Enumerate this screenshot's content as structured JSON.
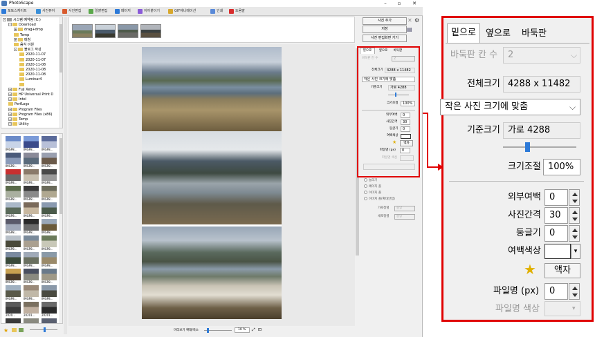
{
  "app": {
    "title": "PhotoScape",
    "tabs": [
      "포토스케이프",
      "사진뷰어",
      "사진편집",
      "일괄편집",
      "페이지",
      "이어붙이기",
      "GIF애니메이션",
      "인쇄",
      "도움말"
    ]
  },
  "tree": {
    "items": [
      {
        "label": "시스템 예약됨 (C:)",
        "indent": 0,
        "sign": "-"
      },
      {
        "label": "Download",
        "indent": 1,
        "sign": "-"
      },
      {
        "label": "drag+drop",
        "indent": 2,
        "sign": "+"
      },
      {
        "label": "Temp",
        "indent": 2,
        "sign": ""
      },
      {
        "label": "매칭",
        "indent": 2,
        "sign": "+"
      },
      {
        "label": "음식 이원",
        "indent": 2,
        "sign": ""
      },
      {
        "label": "블로그 작성",
        "indent": 2,
        "sign": "-"
      },
      {
        "label": "2020-11-07",
        "indent": 3,
        "sign": ""
      },
      {
        "label": "2020-11-07",
        "indent": 3,
        "sign": ""
      },
      {
        "label": "2020-11-08",
        "indent": 3,
        "sign": ""
      },
      {
        "label": "2020-11-08",
        "indent": 3,
        "sign": ""
      },
      {
        "label": "2020-11-08",
        "indent": 3,
        "sign": ""
      },
      {
        "label": "Luminar4",
        "indent": 3,
        "sign": ""
      },
      {
        "label": "",
        "indent": 3,
        "sign": ""
      },
      {
        "label": "Fuji Xerox",
        "indent": 1,
        "sign": "+"
      },
      {
        "label": "HP Universal Print D",
        "indent": 1,
        "sign": "+"
      },
      {
        "label": "Intel",
        "indent": 1,
        "sign": "+"
      },
      {
        "label": "PerfLogs",
        "indent": 1,
        "sign": ""
      },
      {
        "label": "Program Files",
        "indent": 1,
        "sign": "+"
      },
      {
        "label": "Program Files (x86)",
        "indent": 1,
        "sign": "+"
      },
      {
        "label": "Temp",
        "indent": 1,
        "sign": "+"
      },
      {
        "label": "Utility",
        "indent": 1,
        "sign": "+"
      }
    ]
  },
  "thumbnails": {
    "labels": [
      "IMGP8...",
      "IMGP8...",
      "IMGP8...",
      "IMGP8...",
      "IMGP8...",
      "IMGP8...",
      "IMGP8...",
      "IMGP8...",
      "IMGP8...",
      "IMGP8...",
      "IMGP8...",
      "IMGP8...",
      "IMGP8...",
      "IMGP8...",
      "IMGP8...",
      "IMGP8...",
      "IMGP8...",
      "IMGP8...",
      "IMGP8...",
      "IMGP8...",
      "IMGP8...",
      "IMGP8...",
      "IMGP8...",
      "IMGP8...",
      "IMGP8...",
      "IMGP8...",
      "IMGP8...",
      "IMGP8...",
      "IMGP8...",
      "IMGP8...",
      "2020...",
      "20201...",
      "20201...",
      "20201...",
      "20201...",
      "20201..."
    ]
  },
  "zoom_bar": {
    "label": "미리보기 확대/축소",
    "value": "10 %"
  },
  "right_panel": {
    "add_photo": "사진 추가",
    "save": "저장",
    "edit_photo": "사진 편집화면 가기"
  },
  "settings": {
    "tabs": [
      "밑으로",
      "옆으로",
      "바둑판"
    ],
    "grid_cols_label": "바둑판 칸 수",
    "grid_cols_value": "2",
    "total_size_label": "전체크기",
    "total_size_value": "4288 x 11482",
    "fit_option": "작은 사진 크기에 맞춤",
    "base_size_label": "기준크기",
    "base_size_value": "가로 4288",
    "scale_label": "크기조절",
    "scale_value": "100%",
    "outer_margin_label": "외부여백",
    "outer_margin_value": "0",
    "spacing_label": "사진간격",
    "spacing_value": "30",
    "rounding_label": "둥글기",
    "rounding_value": "0",
    "margin_color_label": "여백색상",
    "frame_button": "액자",
    "filename_label": "파일명 (px)",
    "filename_value": "0",
    "filename_color_label": "파일명 색상"
  },
  "options": {
    "items": [
      "늘리기",
      "페이지 폴",
      "이미지 폴",
      "이미지 폴(확대안함)"
    ],
    "h_align_label": "가로정렬",
    "v_align_label": "세로정렬",
    "align_value": "중앙"
  },
  "colors": {
    "accent": "#e00000"
  }
}
